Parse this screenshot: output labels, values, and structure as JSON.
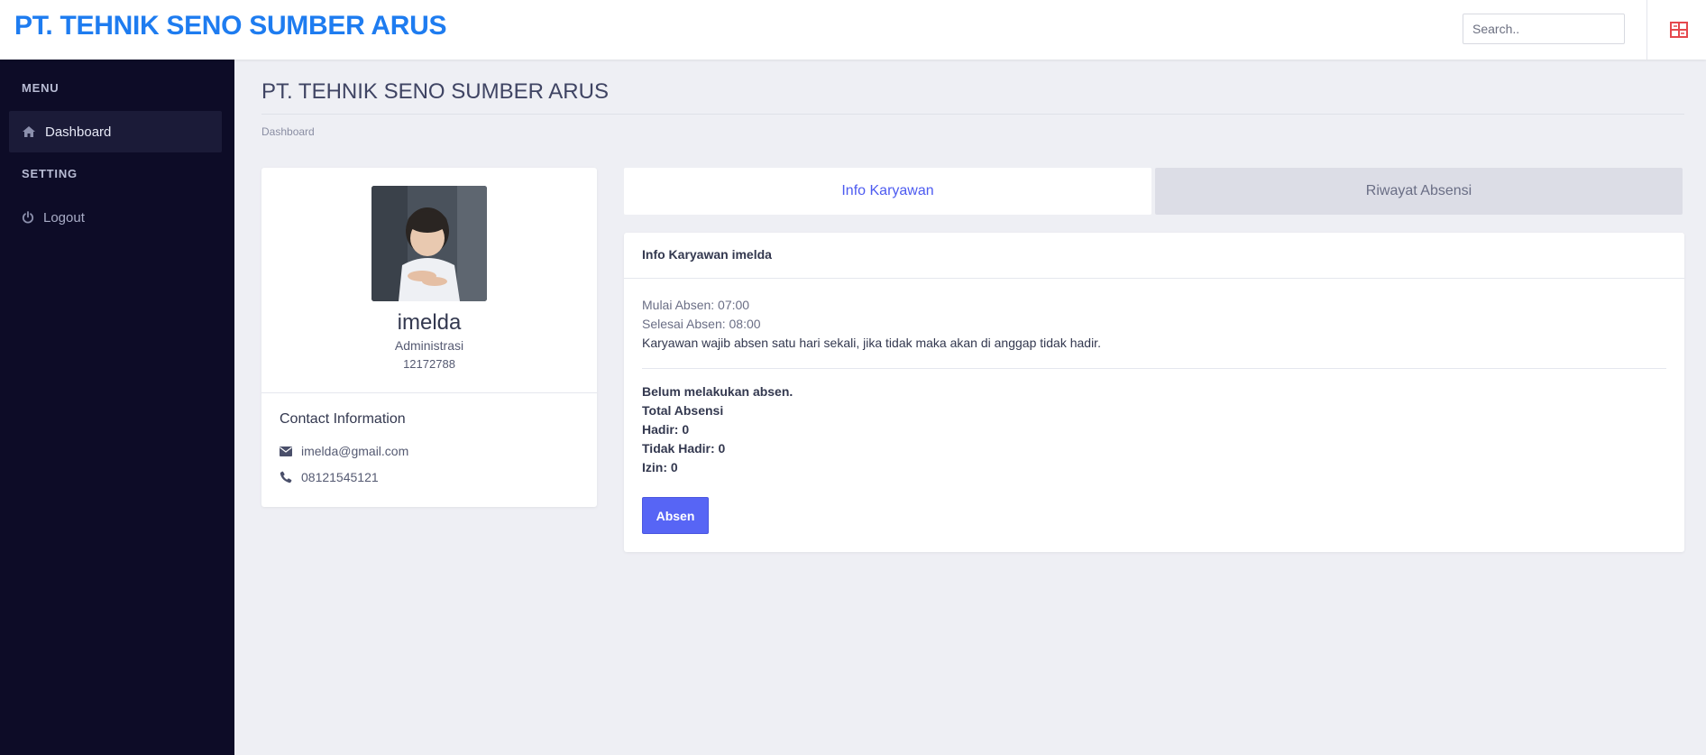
{
  "header": {
    "brand": "PT. TEHNIK SENO SUMBER ARUS",
    "search_placeholder": "Search.."
  },
  "sidebar": {
    "sections": [
      {
        "heading": "MENU",
        "items": [
          {
            "label": "Dashboard",
            "icon": "home-icon",
            "active": true
          }
        ]
      },
      {
        "heading": "SETTING",
        "items": [
          {
            "label": "Logout",
            "icon": "power-icon",
            "active": false
          }
        ]
      }
    ]
  },
  "page": {
    "title": "PT. TEHNIK SENO SUMBER ARUS",
    "breadcrumb": "Dashboard"
  },
  "profile": {
    "name": "imelda",
    "role": "Administrasi",
    "id": "12172788",
    "contact_title": "Contact Information",
    "email": "imelda@gmail.com",
    "phone": "08121545121"
  },
  "tabs": [
    {
      "label": "Info Karyawan",
      "active": true
    },
    {
      "label": "Riwayat Absensi",
      "active": false
    }
  ],
  "info": {
    "header": "Info Karyawan imelda",
    "mulai": "Mulai Absen: 07:00",
    "selesai": "Selesai Absen: 08:00",
    "note": "Karyawan wajib absen satu hari sekali, jika tidak maka akan di anggap tidak hadir.",
    "status": "Belum melakukan absen.",
    "total_label": "Total Absensi",
    "hadir": "Hadir: 0",
    "tidak_hadir": "Tidak Hadir: 0",
    "izin": "Izin: 0",
    "button": "Absen"
  },
  "colors": {
    "brand": "#1e7cf0",
    "sidebar_bg": "#0d0c27",
    "accent": "#5765f5",
    "menu_toggle": "#e5484d"
  }
}
